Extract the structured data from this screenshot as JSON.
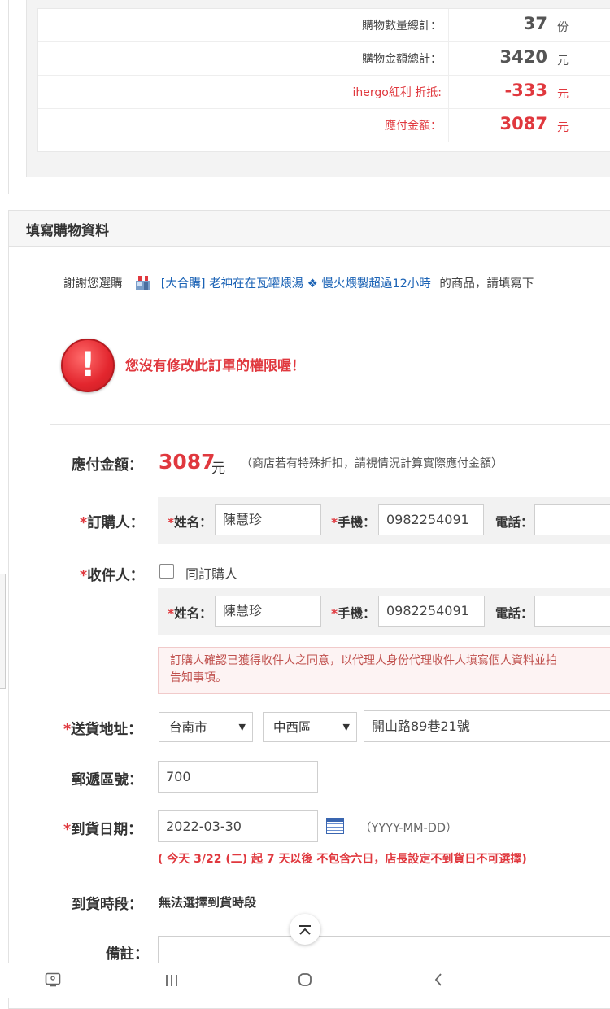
{
  "summary": {
    "rows": [
      {
        "label": "購物數量總計：",
        "value": "37",
        "unit": "份",
        "red": false
      },
      {
        "label": "購物金額總計：",
        "value": "3420",
        "unit": "元",
        "red": false
      },
      {
        "label": "ihergo紅利 折抵:",
        "value": "-333",
        "unit": "元",
        "red": true
      },
      {
        "label": "應付金額：",
        "value": "3087",
        "unit": "元",
        "red": true
      }
    ]
  },
  "form": {
    "title": "填寫購物資料",
    "thanks_prefix": "謝謝您選購",
    "product_link": "[大合購] 老神在在瓦罐煨湯 ❖ 慢火煨製超過12小時",
    "thanks_suffix": "的商品，請填寫下",
    "error_message": "您沒有修改此訂單的權限喔！",
    "pay": {
      "label": "應付金額：",
      "amount": "3087",
      "unit": "元",
      "note": "（商店若有特殊折扣，請視情況計算實際應付金額）"
    },
    "orderer": {
      "label": "訂購人：",
      "name_label": "姓名：",
      "name_value": "陳慧珍",
      "mobile_label": "手機：",
      "mobile_value": "0982254091",
      "phone_label": "電話：",
      "phone_value": ""
    },
    "receiver": {
      "label": "收件人：",
      "same_label": "同訂購人",
      "same_checked": false,
      "name_label": "姓名：",
      "name_value": "陳慧珍",
      "mobile_label": "手機：",
      "mobile_value": "0982254091",
      "phone_label": "電話：",
      "phone_value": ""
    },
    "notice_line1": "訂購人確認已獲得收件人之同意，以代理人身份代理收件人填寫個人資料並拍",
    "notice_line2": "告知事項。",
    "address": {
      "label": "送貨地址：",
      "city": "台南市",
      "district": "中西區",
      "street": "開山路89巷21號"
    },
    "postal": {
      "label": "郵遞區號：",
      "value": "700"
    },
    "arrival": {
      "label": "到貨日期：",
      "value": "2022-03-30",
      "format": "（YYYY-MM-DD）",
      "warning": "( 今天 3/22 (二) 起 7 天以後 不包含六日，店長設定不到貨日不可選擇)"
    },
    "time_slot": {
      "label": "到貨時段：",
      "value": "無法選擇到貨時段"
    },
    "remark": {
      "label": "備註：",
      "value": ""
    }
  },
  "icons": {
    "error": "exclamation-icon",
    "shop": "shop-icon",
    "calendar": "calendar-icon",
    "scroll_top": "chevron-up-icon",
    "nav": [
      "screenshot-icon",
      "recent-apps-icon",
      "home-icon",
      "back-icon"
    ]
  }
}
